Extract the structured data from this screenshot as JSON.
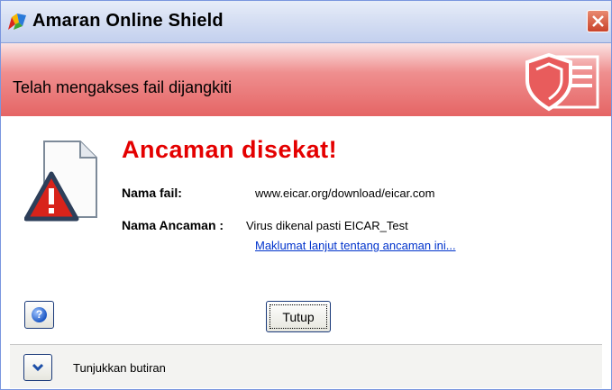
{
  "window": {
    "title": "Amaran Online Shield"
  },
  "banner": {
    "text": "Telah mengakses fail dijangkiti"
  },
  "alert": {
    "title": "Ancaman disekat!",
    "file_label": "Nama fail:",
    "file_value": "www.eicar.org/download/eicar.com",
    "threat_label": "Nama Ancaman :",
    "threat_value": "Virus dikenal pasti EICAR_Test",
    "more_info_link": "Maklumat lanjut tentang ancaman ini..."
  },
  "buttons": {
    "close_label": "Tutup",
    "help_glyph": "?"
  },
  "footer": {
    "details_label": "Tunjukkan butiran"
  },
  "colors": {
    "threat_red": "#e40000",
    "banner_red": "#e56565",
    "link_blue": "#0033cc"
  }
}
